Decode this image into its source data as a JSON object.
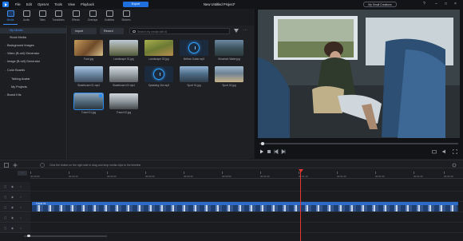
{
  "titlebar": {
    "menu": [
      "File",
      "Edit",
      "OpenAI",
      "Tools",
      "View",
      "Playback"
    ],
    "export_label": "Export",
    "project_title": "New Untitled Project*",
    "credits_label": "My Small Creations"
  },
  "toolbar": {
    "tools": [
      {
        "label": "Media",
        "icon": "media-icon"
      },
      {
        "label": "Audio",
        "icon": "music-icon"
      },
      {
        "label": "Titles",
        "icon": "text-icon"
      },
      {
        "label": "Transitions",
        "icon": "transition-icon"
      },
      {
        "label": "Effects",
        "icon": "effects-icon"
      },
      {
        "label": "Overlays",
        "icon": "overlay-icon"
      },
      {
        "label": "Subtitles",
        "icon": "subtitles-icon"
      },
      {
        "label": "Stickers",
        "icon": "sticker-icon"
      }
    ]
  },
  "sidebar": {
    "items": [
      {
        "label": "My Media",
        "active": true
      },
      {
        "label": "Stock Media"
      },
      {
        "label": "Background Images"
      },
      {
        "label": "Video (B-roll) Generator"
      },
      {
        "label": "Image (B-roll) Generator"
      },
      {
        "label": "Color Boards"
      },
      {
        "label": "Talking Avatar"
      },
      {
        "label": "My Projects"
      },
      {
        "label": "Brand Kits"
      }
    ]
  },
  "media": {
    "import_label": "Import",
    "record_label": "Record",
    "search_placeholder": "Search my media with AI",
    "items": [
      {
        "name": "Food.jpg"
      },
      {
        "name": "Landscape 01.jpg"
      },
      {
        "name": "Landscape 02.jpg"
      },
      {
        "name": "Mellow Guitar.mp3"
      },
      {
        "name": "Mountain Water.jpg"
      },
      {
        "name": "Skateboard 01.mp4"
      },
      {
        "name": "Skateboard 02.mp4"
      },
      {
        "name": "Speaking Out.mp3"
      },
      {
        "name": "Sport 01.jpg"
      },
      {
        "name": "Sport 02.jpg"
      },
      {
        "name": "Travel 01.jpg"
      },
      {
        "name": "Travel 02.jpg"
      }
    ]
  },
  "timeline": {
    "tip": "Click the button on the right side to drag and drop media clips to the timeline",
    "ticks": [
      "00:00:00",
      "00:00:10",
      "00:00:20",
      "00:00:30",
      "00:00:40",
      "00:00:50",
      "00:01:00",
      "00:01:10",
      "00:01:20",
      "00:01:30",
      "00:01:40",
      "00:01:50"
    ],
    "clip_name": "Travel 01"
  }
}
